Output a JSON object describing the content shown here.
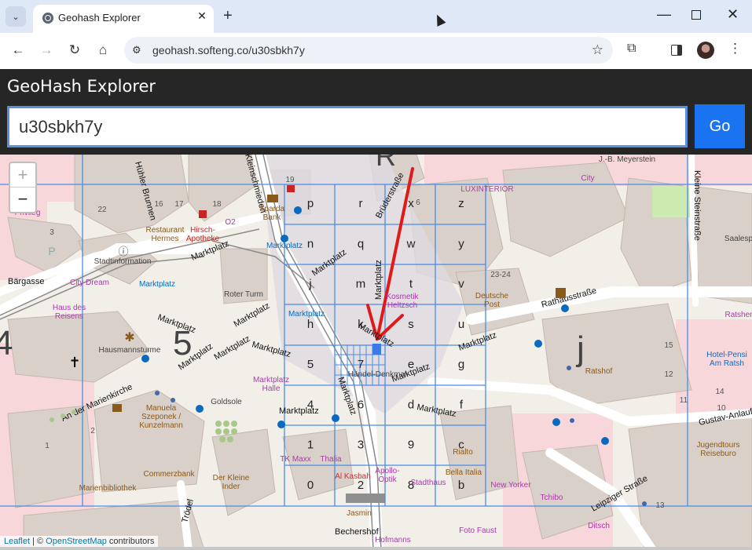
{
  "browser": {
    "tab_title": "Geohash Explorer",
    "url": "geohash.softeng.co/u30sbkh7y",
    "icons": [
      "tab-search-icon",
      "globe-icon",
      "close-icon",
      "plus-icon",
      "back-icon",
      "forward-icon",
      "reload-icon",
      "home-icon",
      "site-info-icon",
      "star-icon",
      "extensions-icon",
      "side-panel-icon",
      "menu-icon"
    ]
  },
  "app": {
    "title": "GeoHash Explorer",
    "hash_value": "u30sbkh7y",
    "go_label": "Go"
  },
  "map": {
    "zoom_in": "+",
    "zoom_out": "−",
    "attribution_leaflet": "Leaflet",
    "attribution_sep": " | © ",
    "attribution_osm": "OpenStreetMap",
    "attribution_tail": " contributors",
    "big_cells": [
      "R",
      "5",
      "j",
      "4"
    ],
    "geohash_cells": [
      "p",
      "r",
      "x",
      "z",
      "n",
      "q",
      "w",
      "y",
      "j",
      "m",
      "t",
      "v",
      "h",
      "k",
      "s",
      "u",
      "5",
      "7",
      "e",
      "g",
      "4",
      "6",
      "d",
      "f",
      "1",
      "3",
      "9",
      "c",
      "0",
      "2",
      "8",
      "b"
    ],
    "street_labels": [
      "Marktplatz",
      "Rathausstraße",
      "An der Marienkirche",
      "Gustav-Anlauf",
      "Leipziger Straße",
      "Kleine Steinstraße",
      "Brüderstraße",
      "Kleinschmieden",
      "Bärgasse",
      "Trödel",
      "Bechershof",
      "Hühler Brunnen"
    ],
    "poi_labels": [
      "Restaurant Hermes",
      "Hirsch-Apotheke",
      "O2",
      "Sparda Bank",
      "Stadtinformation",
      "City Dream",
      "Haus des Reisens",
      "Roter Turm",
      "Hausmannsturme",
      "Marktplatz Halle",
      "Goldsole",
      "Manuela Szeponek / Kunzelmann",
      "Commerzbank",
      "Marienbibliothek",
      "Der Kleine Inder",
      "TK Maxx",
      "Thalia",
      "Al Kasbah",
      "Apollo-Optik",
      "Stadthaus",
      "Rialto",
      "Bella Italia",
      "New Yorker",
      "Tchibo",
      "Ditsch",
      "Jugendtours Reiseburo",
      "Deutsche Post",
      "Ratshof",
      "Hotel-Pension Am Ratshof",
      "Ratsher",
      "Saalesp",
      "LUXINTERIOR",
      "City",
      "J.-B. Meyerstein",
      "Kosmetik Heltzsch",
      "Händel-Denkmal",
      "Jasmin",
      "Hofmanns",
      "Foto Faust",
      "Privileg",
      "Marktplatz"
    ],
    "house_numbers": [
      "19",
      "5",
      "6",
      "4",
      "22",
      "3",
      "16",
      "17",
      "18",
      "15",
      "2",
      "23-24",
      "14",
      "15",
      "12",
      "11",
      "10",
      "13",
      "1",
      "2",
      "1",
      "3",
      "9",
      "8",
      "1",
      "2",
      "9",
      "5",
      "11",
      "12"
    ],
    "colors": {
      "grid": "#4b8be8",
      "marker": "#3a7be8",
      "arrow": "#e01a1a",
      "building": "#d9d0c9",
      "residential": "#f7d7da",
      "road": "#ffffff",
      "square": "#ddd9e0"
    }
  }
}
